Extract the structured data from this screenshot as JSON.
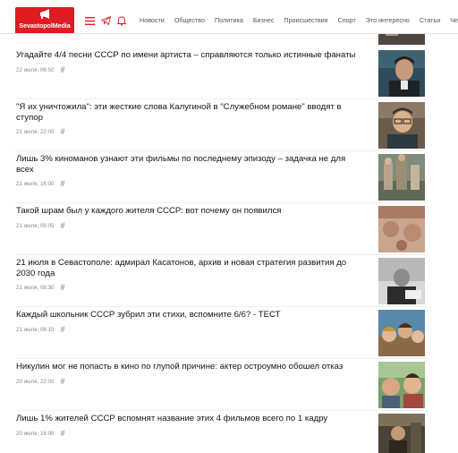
{
  "header": {
    "logo_text": "SevastopolMedia",
    "nav": [
      "Новости",
      "Общество",
      "Политика",
      "Бизнес",
      "Происшествия",
      "Спорт",
      "Это интересно",
      "Статьи",
      "Челл"
    ]
  },
  "articles": [
    {
      "title": "Угадайте 4/4 песни СССР по имени артиста – справляются только истинные фанаты",
      "date": "22 июля, 06:50",
      "tag": "#"
    },
    {
      "title": "\"Я их уничтожила\": эти жесткие слова Калугиной в \"Служебном романе\" вводят в ступор",
      "date": "21 июля, 22:00",
      "tag": "#"
    },
    {
      "title": "Лишь 3% киноманов узнают эти фильмы по последнему эпизоду – задачка не для всех",
      "date": "21 июля, 16:00",
      "tag": "#"
    },
    {
      "title": "Такой шрам был у каждого жителя СССР: вот почему он появился",
      "date": "21 июля, 09:05",
      "tag": "#"
    },
    {
      "title": "21 июля в Севастополе: адмирал Касатонов, архив и новая стратегия развития до 2030 года",
      "date": "21 июля, 08:30",
      "tag": "#"
    },
    {
      "title": "Каждый школьник СССР зубрил эти стихи, вспомните 6/6? - ТЕСТ",
      "date": "21 июля, 08:15",
      "tag": "#"
    },
    {
      "title": "Никулин мог не попасть в кино по глупой причине: актер остроумно обошел отказ",
      "date": "20 июля, 22:00",
      "tag": "#"
    },
    {
      "title": "Лишь 1% жителей СССР вспомнят название этих 4 фильмов всего по 1 кадру",
      "date": "20 июля, 16:00",
      "tag": "#"
    }
  ],
  "colors": {
    "brand": "#e11b22"
  },
  "icons": [
    "megaphone-icon",
    "hamburger-menu-icon",
    "telegram-icon",
    "bell-icon"
  ]
}
